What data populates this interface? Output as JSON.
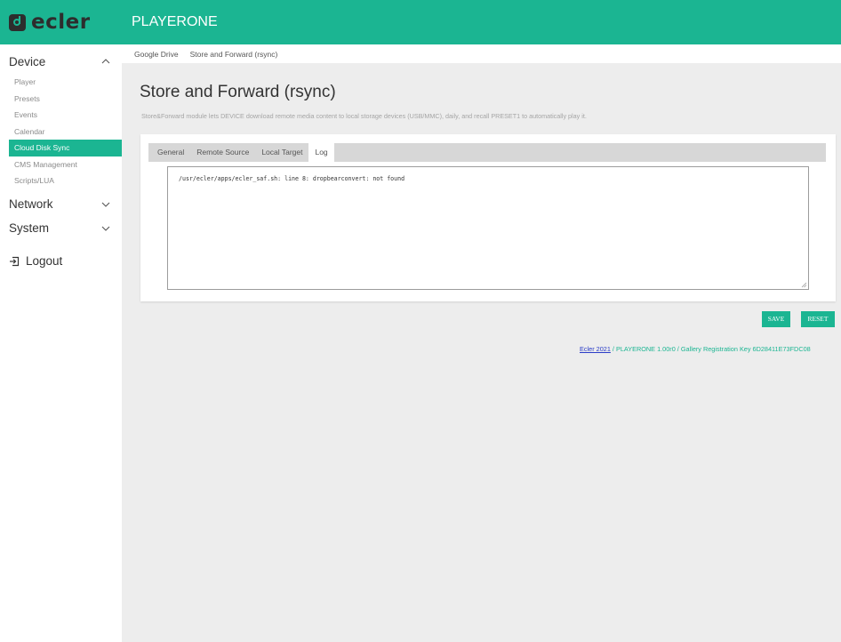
{
  "header": {
    "logo_text": "ecler",
    "app_title": "PLAYERONE",
    "brand_color": "#1bb592"
  },
  "sidebar": {
    "device": {
      "label": "Device",
      "expanded": true,
      "icon": "chevron-up-icon"
    },
    "device_items": [
      {
        "label": "Player",
        "active": false
      },
      {
        "label": "Presets",
        "active": false
      },
      {
        "label": "Events",
        "active": false
      },
      {
        "label": "Calendar",
        "active": false
      },
      {
        "label": "Cloud Disk Sync",
        "active": true
      },
      {
        "label": "CMS Management",
        "active": false
      },
      {
        "label": "Scripts/LUA",
        "active": false
      }
    ],
    "network": {
      "label": "Network",
      "expanded": false,
      "icon": "chevron-down-icon"
    },
    "system": {
      "label": "System",
      "expanded": false,
      "icon": "chevron-down-icon"
    },
    "logout": {
      "label": "Logout",
      "icon": "logout-icon"
    }
  },
  "breadcrumb": [
    "Google Drive",
    "Store and Forward (rsync)"
  ],
  "main": {
    "title": "Store and Forward (rsync)",
    "description": "Store&Forward module lets DEVICE download remote media content to local storage devices (USB/MMC), daily, and recall PRESET1 to automatically play it.",
    "tabs": [
      {
        "label": "General",
        "active": false
      },
      {
        "label": "Remote Source",
        "active": false
      },
      {
        "label": "Local Target",
        "active": false
      },
      {
        "label": "Log",
        "active": true
      }
    ],
    "log_text": "/usr/ecler/apps/ecler_saf.sh: line 8: dropbearconvert: not found"
  },
  "buttons": {
    "save": "SAVE",
    "reset": "RESET"
  },
  "footer": {
    "link_text": "Ecler 2021",
    "text": " / PLAYERONE 1.00r0 / Gallery Registration Key 6D28411E73FDC08"
  }
}
